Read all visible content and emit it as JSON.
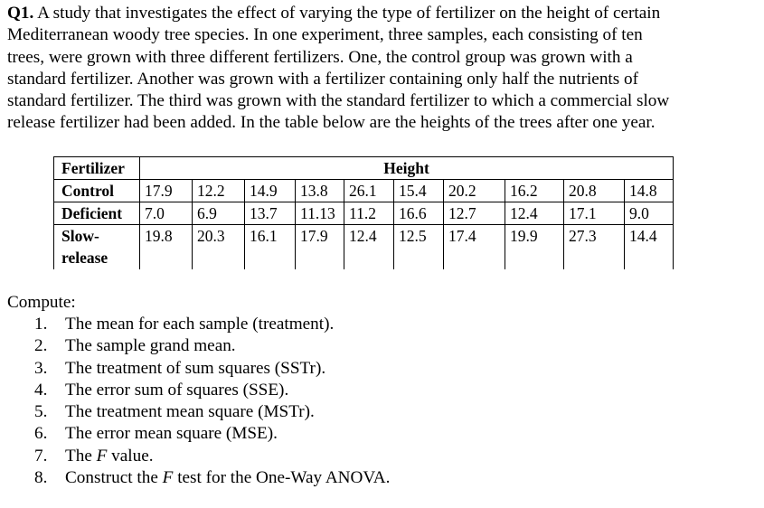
{
  "question": {
    "label": "Q1.",
    "lines": [
      " A study that investigates the effect of varying the type of fertilizer on the height of certain",
      "Mediterranean woody tree species. In one experiment, three samples, each consisting of ten",
      "trees, were grown with three different fertilizers. One, the control group was grown with a",
      "standard fertilizer. Another was grown with a fertilizer containing only half the nutrients of",
      "standard fertilizer. The third was grown with the standard fertilizer to which a commercial slow",
      "release fertilizer had been added. In the table below are the heights of the trees after one year."
    ]
  },
  "table": {
    "header_left": "Fertilizer",
    "header_right": "Height",
    "rows": [
      {
        "label": "Control",
        "values": [
          "17.9",
          "12.2",
          "14.9",
          "13.8",
          "26.1",
          "15.4",
          "20.2",
          "16.2",
          "20.8",
          "14.8"
        ]
      },
      {
        "label": "Deficient",
        "values": [
          "7.0",
          "6.9",
          "13.7",
          "11.13",
          "11.2",
          "16.6",
          "12.7",
          "12.4",
          "17.1",
          "9.0"
        ]
      },
      {
        "label_line1": "Slow-",
        "label_line2": "release",
        "values": [
          "19.8",
          "20.3",
          "16.1",
          "17.9",
          "12.4",
          "12.5",
          "17.4",
          "19.9",
          "27.3",
          "14.4"
        ]
      }
    ]
  },
  "compute": {
    "heading": "Compute:",
    "items": [
      {
        "num": "1.",
        "text": "The mean for each sample (treatment)."
      },
      {
        "num": "2.",
        "text": "The sample grand mean."
      },
      {
        "num": "3.",
        "text": "The treatment of sum squares (SSTr)."
      },
      {
        "num": "4.",
        "text": "The error sum of squares (SSE)."
      },
      {
        "num": "5.",
        "text": "The treatment mean square (MSTr)."
      },
      {
        "num": "6.",
        "text": "The error mean square (MSE)."
      },
      {
        "num": "7.",
        "pre": "The ",
        "italic": "F",
        "post": " value."
      },
      {
        "num": "8.",
        "pre": "Construct the ",
        "italic": "F",
        "post": " test for the One-Way ANOVA."
      }
    ]
  }
}
